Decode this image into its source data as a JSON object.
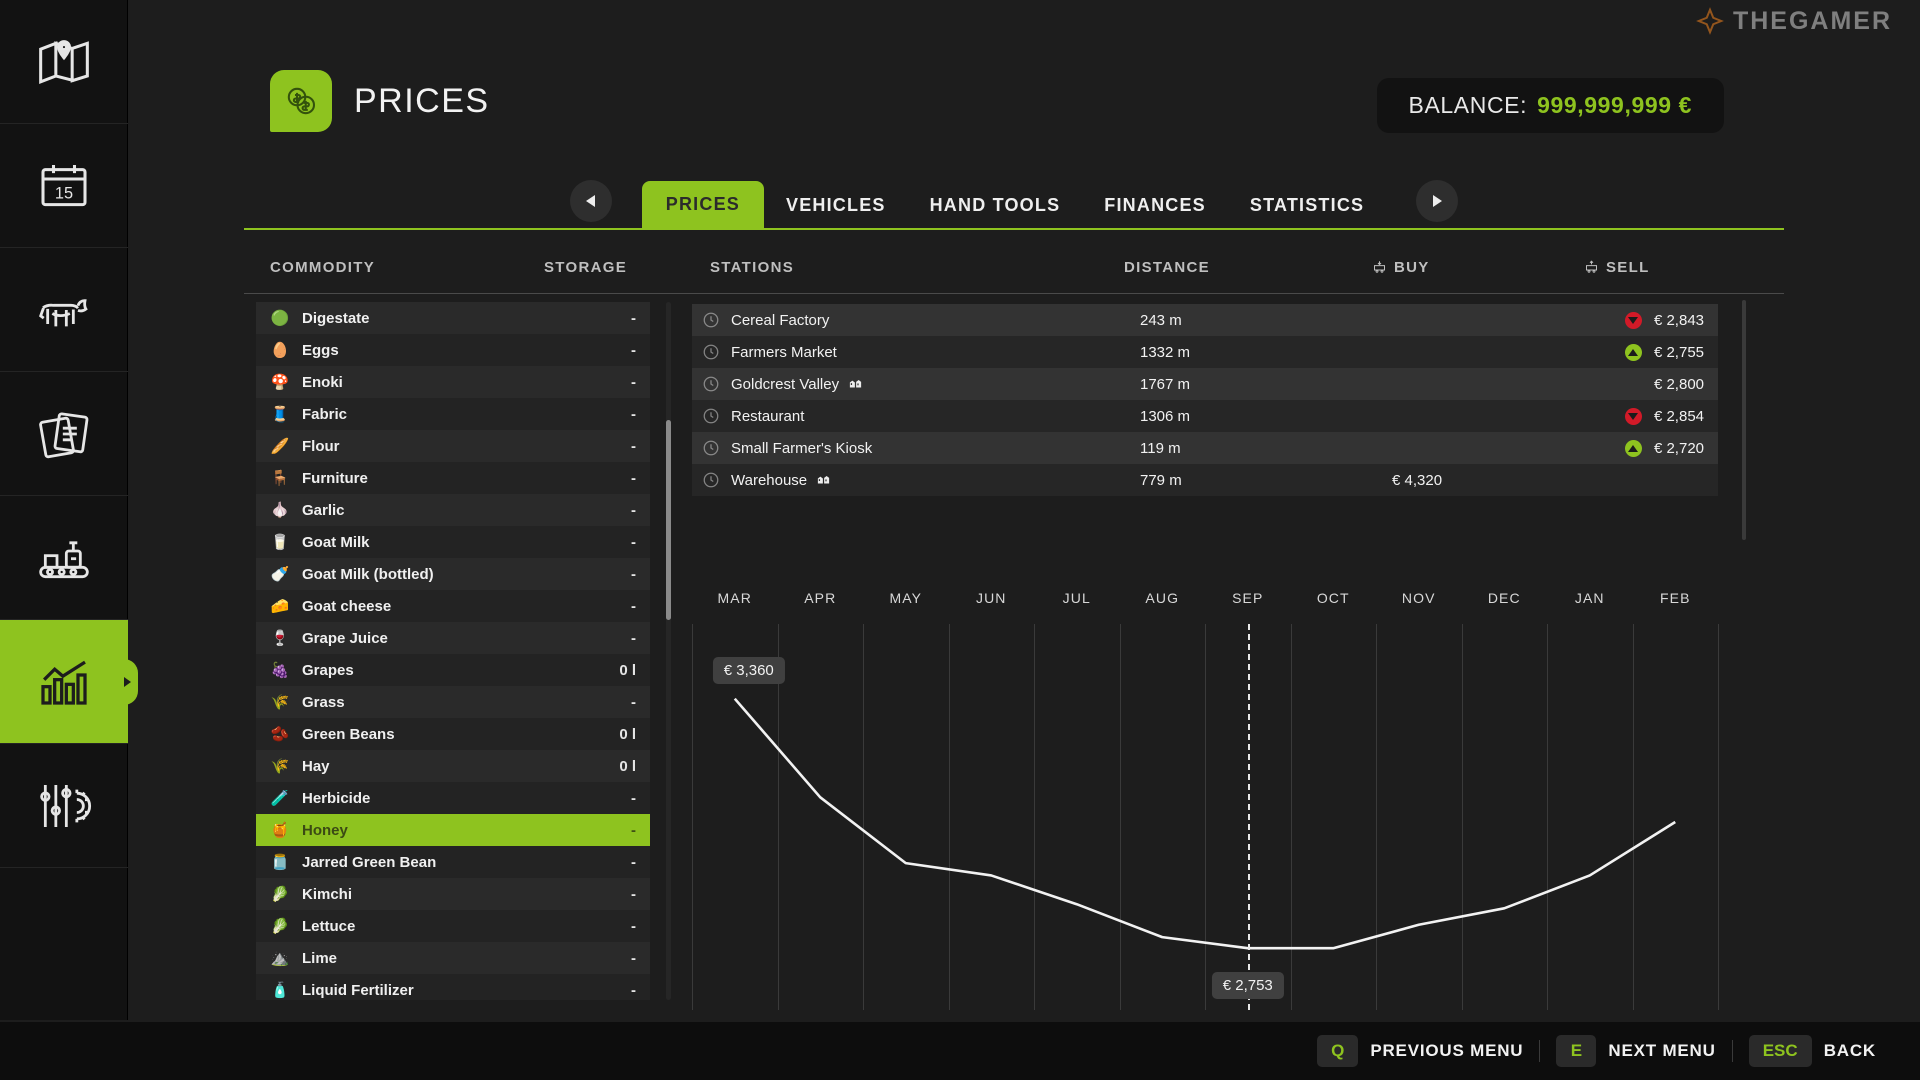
{
  "header": {
    "title": "PRICES",
    "app_icon": "coins-icon",
    "balance_label": "BALANCE:",
    "balance_value": "999,999,999 €"
  },
  "sidebar": {
    "items": [
      {
        "name": "map",
        "icon": "map-icon",
        "active": false
      },
      {
        "name": "calendar",
        "icon": "calendar-icon",
        "active": false,
        "day": "15"
      },
      {
        "name": "animals",
        "icon": "cow-icon",
        "active": false
      },
      {
        "name": "contracts",
        "icon": "documents-icon",
        "active": false
      },
      {
        "name": "production",
        "icon": "conveyor-icon",
        "active": false
      },
      {
        "name": "statistics",
        "icon": "bar-chart-icon",
        "active": true
      },
      {
        "name": "settings",
        "icon": "sliders-gear-icon",
        "active": false
      }
    ]
  },
  "tabs": {
    "prev_label": "◀",
    "next_label": "▶",
    "items": [
      {
        "label": "PRICES",
        "active": true
      },
      {
        "label": "VEHICLES",
        "active": false
      },
      {
        "label": "HAND TOOLS",
        "active": false
      },
      {
        "label": "FINANCES",
        "active": false
      },
      {
        "label": "STATISTICS",
        "active": false
      }
    ]
  },
  "columns": {
    "commodity": "COMMODITY",
    "storage": "STORAGE",
    "stations": "STATIONS",
    "distance": "DISTANCE",
    "buy": "BUY",
    "sell": "SELL"
  },
  "commodities": [
    {
      "name": "Digestate",
      "storage": "-",
      "icon": "🟢",
      "selected": false
    },
    {
      "name": "Eggs",
      "storage": "-",
      "icon": "🥚",
      "selected": false
    },
    {
      "name": "Enoki",
      "storage": "-",
      "icon": "🍄",
      "selected": false
    },
    {
      "name": "Fabric",
      "storage": "-",
      "icon": "🧵",
      "selected": false
    },
    {
      "name": "Flour",
      "storage": "-",
      "icon": "🥖",
      "selected": false
    },
    {
      "name": "Furniture",
      "storage": "-",
      "icon": "🪑",
      "selected": false
    },
    {
      "name": "Garlic",
      "storage": "-",
      "icon": "🧄",
      "selected": false
    },
    {
      "name": "Goat Milk",
      "storage": "-",
      "icon": "🥛",
      "selected": false
    },
    {
      "name": "Goat Milk (bottled)",
      "storage": "-",
      "icon": "🍼",
      "selected": false
    },
    {
      "name": "Goat cheese",
      "storage": "-",
      "icon": "🧀",
      "selected": false
    },
    {
      "name": "Grape Juice",
      "storage": "-",
      "icon": "🍷",
      "selected": false
    },
    {
      "name": "Grapes",
      "storage": "0 l",
      "icon": "🍇",
      "selected": false
    },
    {
      "name": "Grass",
      "storage": "-",
      "icon": "🌾",
      "selected": false
    },
    {
      "name": "Green Beans",
      "storage": "0 l",
      "icon": "🫘",
      "selected": false
    },
    {
      "name": "Hay",
      "storage": "0 l",
      "icon": "🌾",
      "selected": false
    },
    {
      "name": "Herbicide",
      "storage": "-",
      "icon": "🧪",
      "selected": false
    },
    {
      "name": "Honey",
      "storage": "-",
      "icon": "🍯",
      "selected": true
    },
    {
      "name": "Jarred Green Bean",
      "storage": "-",
      "icon": "🫙",
      "selected": false
    },
    {
      "name": "Kimchi",
      "storage": "-",
      "icon": "🥬",
      "selected": false
    },
    {
      "name": "Lettuce",
      "storage": "-",
      "icon": "🥬",
      "selected": false
    },
    {
      "name": "Lime",
      "storage": "-",
      "icon": "⛰️",
      "selected": false
    },
    {
      "name": "Liquid Fertilizer",
      "storage": "-",
      "icon": "🧴",
      "selected": false
    }
  ],
  "stations": [
    {
      "name": "Cereal Factory",
      "distance": "243 m",
      "buy": "",
      "sell": "€ 2,843",
      "trend": "down",
      "owned": false
    },
    {
      "name": "Farmers Market",
      "distance": "1332 m",
      "buy": "",
      "sell": "€ 2,755",
      "trend": "up",
      "owned": false
    },
    {
      "name": "Goldcrest Valley",
      "distance": "1767 m",
      "buy": "",
      "sell": "€ 2,800",
      "trend": "none",
      "owned": true
    },
    {
      "name": "Restaurant",
      "distance": "1306 m",
      "buy": "",
      "sell": "€ 2,854",
      "trend": "down",
      "owned": false
    },
    {
      "name": "Small Farmer's Kiosk",
      "distance": "119 m",
      "buy": "",
      "sell": "€ 2,720",
      "trend": "up",
      "owned": false
    },
    {
      "name": "Warehouse",
      "distance": "779 m",
      "buy": "€ 4,320",
      "sell": "",
      "trend": "none",
      "owned": true
    }
  ],
  "chart_data": {
    "type": "line",
    "title": "",
    "xlabel": "",
    "ylabel": "",
    "grid": true,
    "legend": "none",
    "categories": [
      "MAR",
      "APR",
      "MAY",
      "JUN",
      "JUL",
      "AUG",
      "SEP",
      "OCT",
      "NOV",
      "DEC",
      "JAN",
      "FEB"
    ],
    "series": [
      {
        "name": "Honey price",
        "values": [
          3360,
          3120,
          2960,
          2930,
          2860,
          2780,
          2753,
          2753,
          2810,
          2850,
          2930,
          3060
        ]
      }
    ],
    "ylim": [
      2700,
      3420
    ],
    "annotations": [
      {
        "label": "€ 3,360",
        "at": "MAR",
        "position": "top-left"
      },
      {
        "label": "€ 2,753",
        "at": "SEP",
        "position": "bottom-cursor"
      }
    ],
    "cursor_month": "SEP",
    "cursor_style": "dashed"
  },
  "bottom_bar": {
    "hints": [
      {
        "key": "Q",
        "label": "PREVIOUS MENU"
      },
      {
        "key": "E",
        "label": "NEXT MENU"
      },
      {
        "key": "ESC",
        "label": "BACK"
      }
    ],
    "watermark": "THEGAMER"
  },
  "colors": {
    "accent": "#8ec31f",
    "up": "#8ec31f",
    "down": "#d21a28",
    "panel": "#1d1d1d",
    "row": "#2a2a2a",
    "row_alt": "#232323"
  }
}
